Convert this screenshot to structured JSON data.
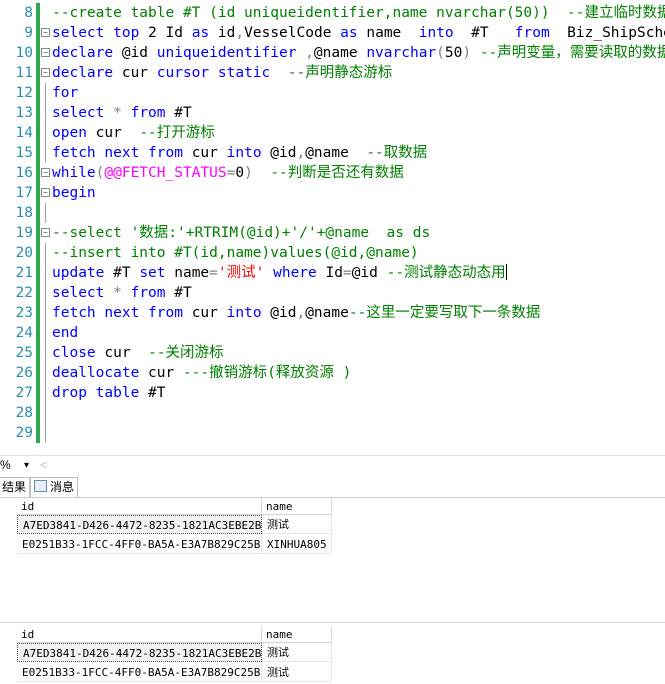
{
  "editor": {
    "lines": [
      {
        "n": "8",
        "segs": [
          {
            "t": "--create table #T (id uniqueidentifier,name nvarchar(50))  --建立临时数据表",
            "c": "cm"
          }
        ]
      },
      {
        "n": "9",
        "segs": [
          {
            "t": "select",
            "c": "kw"
          },
          {
            "t": " ",
            "c": ""
          },
          {
            "t": "top",
            "c": "kw"
          },
          {
            "t": " 2 Id ",
            "c": ""
          },
          {
            "t": "as",
            "c": "kw"
          },
          {
            "t": " id",
            "c": ""
          },
          {
            "t": ",",
            "c": "gr"
          },
          {
            "t": "VesselCode ",
            "c": ""
          },
          {
            "t": "as",
            "c": "kw"
          },
          {
            "t": " name  ",
            "c": ""
          },
          {
            "t": "into",
            "c": "kw"
          },
          {
            "t": "  #T   ",
            "c": ""
          },
          {
            "t": "from",
            "c": "kw"
          },
          {
            "t": "  Biz_ShipSchedule",
            "c": ""
          }
        ]
      },
      {
        "n": "10",
        "segs": [
          {
            "t": "declare",
            "c": "kw"
          },
          {
            "t": " @id ",
            "c": ""
          },
          {
            "t": "uniqueidentifier",
            "c": "kw"
          },
          {
            "t": " ,",
            "c": "gr"
          },
          {
            "t": "@name ",
            "c": ""
          },
          {
            "t": "nvarchar",
            "c": "kw"
          },
          {
            "t": "(",
            "c": "gr"
          },
          {
            "t": "50",
            "c": ""
          },
          {
            "t": ")",
            "c": "gr"
          },
          {
            "t": " --声明变量，需要读取的数据",
            "c": "cm"
          }
        ]
      },
      {
        "n": "11",
        "segs": [
          {
            "t": "declare",
            "c": "kw"
          },
          {
            "t": " cur ",
            "c": ""
          },
          {
            "t": "cursor",
            "c": "kw"
          },
          {
            "t": " ",
            "c": ""
          },
          {
            "t": "static",
            "c": "kw"
          },
          {
            "t": "  --声明静态游标",
            "c": "cm"
          }
        ]
      },
      {
        "n": "12",
        "segs": [
          {
            "t": "for",
            "c": "kw"
          }
        ]
      },
      {
        "n": "13",
        "segs": [
          {
            "t": "select",
            "c": "kw"
          },
          {
            "t": " * ",
            "c": "gr"
          },
          {
            "t": "from",
            "c": "kw"
          },
          {
            "t": " #T",
            "c": ""
          }
        ]
      },
      {
        "n": "14",
        "segs": [
          {
            "t": "open",
            "c": "kw"
          },
          {
            "t": " cur  ",
            "c": ""
          },
          {
            "t": "--打开游标",
            "c": "cm"
          }
        ]
      },
      {
        "n": "15",
        "segs": [
          {
            "t": "fetch",
            "c": "kw"
          },
          {
            "t": " ",
            "c": ""
          },
          {
            "t": "next",
            "c": "kw"
          },
          {
            "t": " ",
            "c": ""
          },
          {
            "t": "from",
            "c": "kw"
          },
          {
            "t": " cur ",
            "c": ""
          },
          {
            "t": "into",
            "c": "kw"
          },
          {
            "t": " @id",
            "c": ""
          },
          {
            "t": ",",
            "c": "gr"
          },
          {
            "t": "@name  ",
            "c": ""
          },
          {
            "t": "--取数据",
            "c": "cm"
          }
        ]
      },
      {
        "n": "16",
        "segs": [
          {
            "t": "while",
            "c": "kw"
          },
          {
            "t": "(",
            "c": "gr"
          },
          {
            "t": "@@FETCH_STATUS",
            "c": "fn"
          },
          {
            "t": "=",
            "c": "gr"
          },
          {
            "t": "0",
            "c": ""
          },
          {
            "t": ")",
            "c": "gr"
          },
          {
            "t": "  --判断是否还有数据",
            "c": "cm"
          }
        ]
      },
      {
        "n": "17",
        "segs": [
          {
            "t": "begin",
            "c": "kw"
          }
        ]
      },
      {
        "n": "18",
        "segs": []
      },
      {
        "n": "19",
        "segs": [
          {
            "t": "--select '数据:'+RTRIM(@id)+'/'+@name  as ds",
            "c": "cm"
          }
        ]
      },
      {
        "n": "20",
        "segs": [
          {
            "t": "--insert into #T(id,name)values(@id,@name)",
            "c": "cm"
          }
        ]
      },
      {
        "n": "21",
        "segs": [
          {
            "t": "update",
            "c": "kw"
          },
          {
            "t": " #T ",
            "c": ""
          },
          {
            "t": "set",
            "c": "kw"
          },
          {
            "t": " name",
            "c": ""
          },
          {
            "t": "=",
            "c": "gr"
          },
          {
            "t": "'测试'",
            "c": "st"
          },
          {
            "t": " ",
            "c": ""
          },
          {
            "t": "where",
            "c": "kw"
          },
          {
            "t": " Id",
            "c": ""
          },
          {
            "t": "=",
            "c": "gr"
          },
          {
            "t": "@id ",
            "c": ""
          },
          {
            "t": "--测试静态动态用",
            "c": "cm"
          }
        ]
      },
      {
        "n": "22",
        "segs": [
          {
            "t": "select",
            "c": "kw"
          },
          {
            "t": " * ",
            "c": "gr"
          },
          {
            "t": "from",
            "c": "kw"
          },
          {
            "t": " #T",
            "c": ""
          }
        ]
      },
      {
        "n": "23",
        "segs": [
          {
            "t": "fetch",
            "c": "kw"
          },
          {
            "t": " ",
            "c": ""
          },
          {
            "t": "next",
            "c": "kw"
          },
          {
            "t": " ",
            "c": ""
          },
          {
            "t": "from",
            "c": "kw"
          },
          {
            "t": " cur ",
            "c": ""
          },
          {
            "t": "into",
            "c": "kw"
          },
          {
            "t": " @id",
            "c": ""
          },
          {
            "t": ",",
            "c": "gr"
          },
          {
            "t": "@name",
            "c": ""
          },
          {
            "t": "--这里一定要写取下一条数据",
            "c": "cm"
          }
        ]
      },
      {
        "n": "24",
        "segs": [
          {
            "t": "end",
            "c": "kw"
          }
        ]
      },
      {
        "n": "25",
        "segs": [
          {
            "t": "close",
            "c": "kw"
          },
          {
            "t": " cur  ",
            "c": ""
          },
          {
            "t": "--关闭游标",
            "c": "cm"
          }
        ]
      },
      {
        "n": "26",
        "segs": [
          {
            "t": "deallocate",
            "c": "kw"
          },
          {
            "t": " cur ",
            "c": ""
          },
          {
            "t": "---撤销游标(释放资源 )",
            "c": "cm"
          }
        ]
      },
      {
        "n": "27",
        "segs": [
          {
            "t": "drop",
            "c": "kw"
          },
          {
            "t": " ",
            "c": ""
          },
          {
            "t": "table",
            "c": "kw"
          },
          {
            "t": " #T",
            "c": ""
          }
        ]
      },
      {
        "n": "28",
        "segs": []
      },
      {
        "n": "29",
        "segs": []
      }
    ]
  },
  "zoom": {
    "value": "%",
    "dropdown": "▾",
    "scroll": "<"
  },
  "tabs": {
    "results": "结果",
    "messages": "消息"
  },
  "grid1": {
    "headers": [
      "id",
      "name"
    ],
    "rows": [
      [
        "A7ED3841-D426-4472-8235-1821AC3EBE2B",
        "测试"
      ],
      [
        "E0251B33-1FCC-4FF0-BA5A-E3A7B829C25B",
        "XINHUA805"
      ]
    ]
  },
  "grid2": {
    "headers": [
      "id",
      "name"
    ],
    "rows": [
      [
        "A7ED3841-D426-4472-8235-1821AC3EBE2B",
        "测试"
      ],
      [
        "E0251B33-1FCC-4FF0-BA5A-E3A7B829C25B",
        "测试"
      ]
    ]
  },
  "colors": {
    "keyword": "#0000ff",
    "comment": "#008000",
    "string": "#ff0000",
    "system_fn": "#ff00ff",
    "line_number": "#2b91af"
  }
}
